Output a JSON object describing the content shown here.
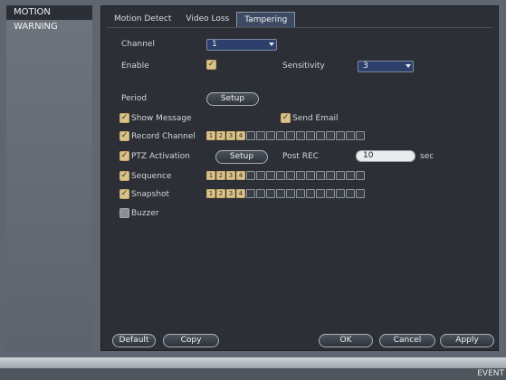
{
  "sidebar": {
    "items": [
      {
        "label": "MOTION",
        "active": true
      },
      {
        "label": "WARNING",
        "active": false
      }
    ]
  },
  "tabs": [
    {
      "label": "Motion Detect",
      "active": false
    },
    {
      "label": "Video Loss",
      "active": false
    },
    {
      "label": "Tampering",
      "active": true
    }
  ],
  "form": {
    "channel": {
      "label": "Channel",
      "value": "1"
    },
    "enable": {
      "label": "Enable",
      "checked": true
    },
    "sensitivity": {
      "label": "Sensitivity",
      "value": "3"
    },
    "period": {
      "label": "Period",
      "button": "Setup"
    },
    "show_message": {
      "label": "Show Message",
      "checked": true
    },
    "send_email": {
      "label": "Send Email",
      "checked": true
    },
    "record_channel": {
      "label": "Record Channel",
      "checked": true
    },
    "ptz_activation": {
      "label": "PTZ Activation",
      "checked": true,
      "button": "Setup"
    },
    "post_rec": {
      "label": "Post REC",
      "value": "10",
      "unit": "sec"
    },
    "sequence": {
      "label": "Sequence",
      "checked": true
    },
    "snapshot": {
      "label": "Snapshot",
      "checked": true
    },
    "buzzer": {
      "label": "Buzzer",
      "checked": false
    }
  },
  "channel_grid": {
    "labels": [
      "1",
      "2",
      "3",
      "4"
    ],
    "total_boxes": 16
  },
  "buttons": {
    "default": "Default",
    "copy": "Copy",
    "ok": "OK",
    "cancel": "Cancel",
    "apply": "Apply"
  },
  "status": {
    "event_label": "EVENT"
  },
  "colors": {
    "accent": "#2d3f6a",
    "checkbox": "#d9c28c",
    "panel": "#2c3036"
  }
}
